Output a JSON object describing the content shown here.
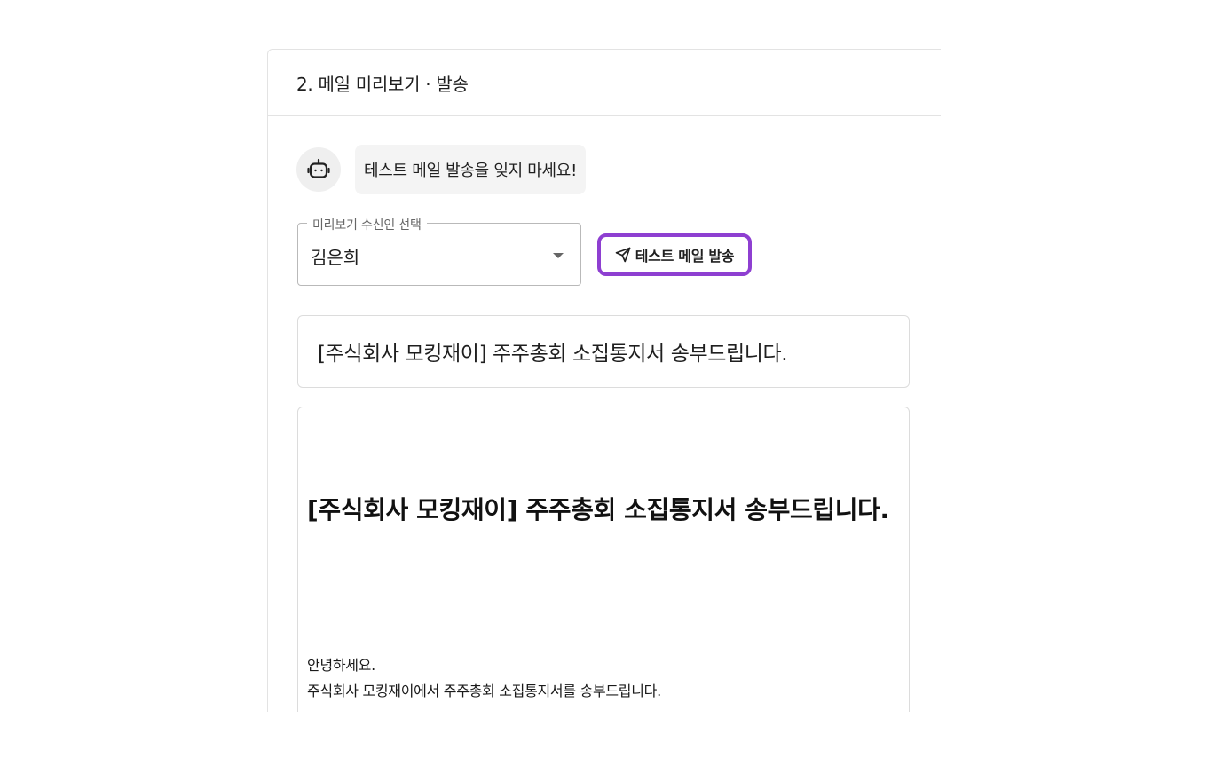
{
  "section": {
    "title": "2. 메일 미리보기 · 발송"
  },
  "assistant": {
    "icon": "robot-icon",
    "message": "테스트 메일 발송을 잊지 마세요!"
  },
  "recipient_select": {
    "label": "미리보기 수신인 선택",
    "value": "김은희"
  },
  "test_send": {
    "icon": "send-icon",
    "label": "테스트 메일 발송",
    "highlight_color": "#8e3fd1"
  },
  "preview": {
    "subject": "[주식회사 모킹재이] 주주총회 소집통지서 송부드립니다.",
    "heading": "[주식회사 모킹재이] 주주총회 소집통지서 송부드립니다.",
    "paragraphs": [
      "안녕하세요.",
      "주식회사 모킹재이에서 주주총회 소집통지서를 송부드립니다."
    ]
  }
}
